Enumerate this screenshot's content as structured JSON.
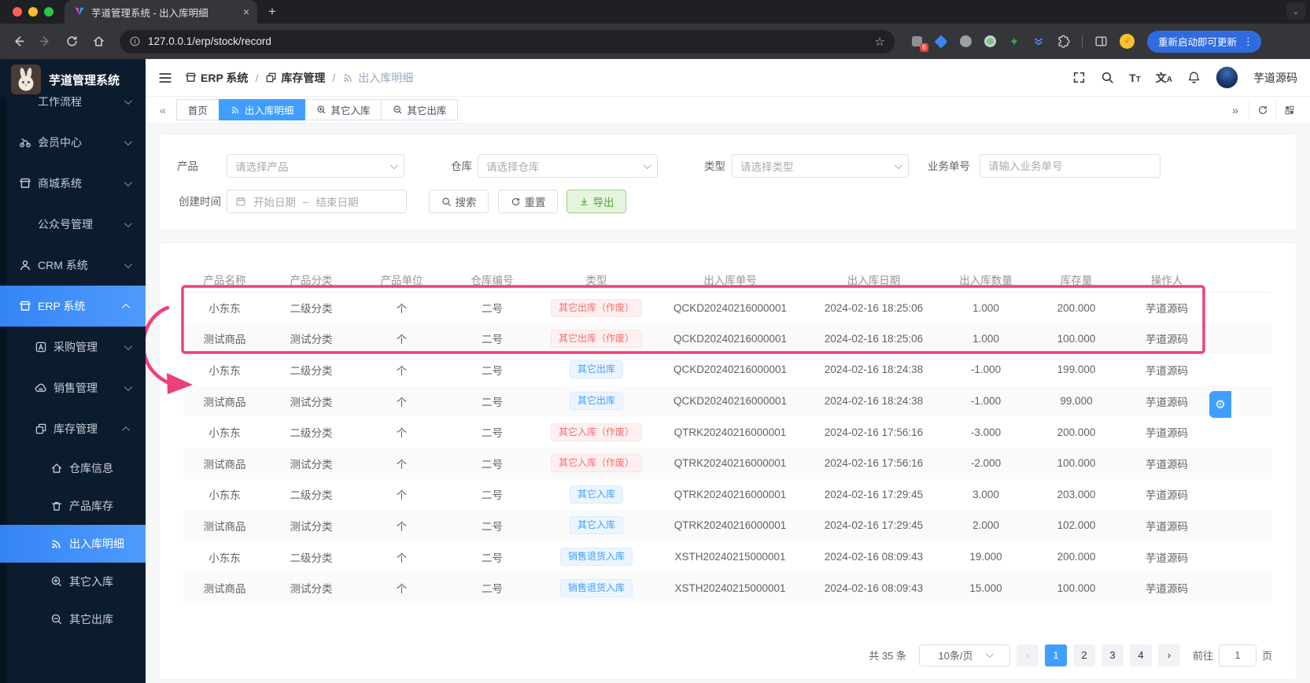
{
  "colors": {
    "accent": "#409eff",
    "annotation": "#ee4079",
    "tag_danger": "#f56c6c",
    "tag_primary": "#409eff",
    "success_button": "#51a83a",
    "sidebar_bg": "#0c1c2f"
  },
  "browser": {
    "tab_title": "芋道管理系统 - 出入库明细",
    "url": "127.0.0.1/erp/stock/record",
    "ext_badge": "6",
    "update_button": "重新启动即可更新"
  },
  "sidebar": {
    "app_title": "芋道管理系统",
    "items": [
      {
        "id": "workflow",
        "label": "工作流程",
        "icon": "",
        "level": 1,
        "chevron": "down",
        "cropped": true
      },
      {
        "id": "member-center",
        "label": "会员中心",
        "icon": "bike",
        "level": 1,
        "chevron": "down"
      },
      {
        "id": "mall-system",
        "label": "商城系统",
        "icon": "shop",
        "level": 1,
        "chevron": "down"
      },
      {
        "id": "mp-admin",
        "label": "公众号管理",
        "icon": "",
        "level": 1,
        "chevron": "down"
      },
      {
        "id": "crm-system",
        "label": "CRM 系统",
        "icon": "user",
        "level": 1,
        "chevron": "down"
      },
      {
        "id": "erp-system",
        "label": "ERP 系统",
        "icon": "shop",
        "level": 1,
        "chevron": "up",
        "active": true
      },
      {
        "id": "purchase",
        "label": "采购管理",
        "icon": "letter-a",
        "level": 2,
        "chevron": "down"
      },
      {
        "id": "sales",
        "label": "销售管理",
        "icon": "cloud",
        "level": 2,
        "chevron": "down"
      },
      {
        "id": "stock",
        "label": "库存管理",
        "icon": "squares",
        "level": 2,
        "chevron": "up"
      },
      {
        "id": "warehouse-info",
        "label": "仓库信息",
        "icon": "home",
        "level": 3
      },
      {
        "id": "product-stock",
        "label": "产品库存",
        "icon": "trash",
        "level": 3
      },
      {
        "id": "stock-record",
        "label": "出入库明细",
        "icon": "signal",
        "level": 3,
        "active": true
      },
      {
        "id": "other-in",
        "label": "其它入库",
        "icon": "zoom-plus",
        "level": 3
      },
      {
        "id": "other-out",
        "label": "其它出库",
        "icon": "zoom-minus",
        "level": 3
      }
    ]
  },
  "header": {
    "breadcrumb": [
      {
        "label": "ERP 系统",
        "icon": "shop"
      },
      {
        "label": "库存管理",
        "icon": "squares"
      },
      {
        "label": "出入库明细",
        "icon": "signal"
      }
    ],
    "breadcrumb_sep": "/",
    "username": "芋道源码"
  },
  "tabs": [
    {
      "id": "home",
      "label": "首页",
      "icon": ""
    },
    {
      "id": "stock-record",
      "label": "出入库明细",
      "icon": "signal",
      "active": true
    },
    {
      "id": "other-in",
      "label": "其它入库",
      "icon": "zoom-plus"
    },
    {
      "id": "other-out",
      "label": "其它出库",
      "icon": "zoom-minus"
    }
  ],
  "filters": {
    "product_label": "产品",
    "product_placeholder": "请选择产品",
    "warehouse_label": "仓库",
    "warehouse_placeholder": "请选择仓库",
    "type_label": "类型",
    "type_placeholder": "请选择类型",
    "bizno_label": "业务单号",
    "bizno_placeholder": "请输入业务单号",
    "created_label": "创建时间",
    "start_placeholder": "开始日期",
    "range_separator": "–",
    "end_placeholder": "结束日期",
    "search_label": "搜索",
    "reset_label": "重置",
    "export_label": "导出"
  },
  "table": {
    "columns": [
      "产品名称",
      "产品分类",
      "产品单位",
      "仓库编号",
      "类型",
      "出入库单号",
      "出入库日期",
      "出入库数量",
      "库存量",
      "操作人"
    ],
    "rows": [
      {
        "product": "小东东",
        "category": "二级分类",
        "unit": "个",
        "warehouse": "二号",
        "type": "其它出库（作废）",
        "variant": "danger",
        "order_no": "QCKD20240216000001",
        "date": "2024-02-16 18:25:06",
        "qty": "1.000",
        "stock": "200.000",
        "operator": "芋道源码"
      },
      {
        "product": "测试商品",
        "category": "测试分类",
        "unit": "个",
        "warehouse": "二号",
        "type": "其它出库（作废）",
        "variant": "danger",
        "order_no": "QCKD20240216000001",
        "date": "2024-02-16 18:25:06",
        "qty": "1.000",
        "stock": "100.000",
        "operator": "芋道源码"
      },
      {
        "product": "小东东",
        "category": "二级分类",
        "unit": "个",
        "warehouse": "二号",
        "type": "其它出库",
        "variant": "primary",
        "order_no": "QCKD20240216000001",
        "date": "2024-02-16 18:24:38",
        "qty": "-1.000",
        "stock": "199.000",
        "operator": "芋道源码"
      },
      {
        "product": "测试商品",
        "category": "测试分类",
        "unit": "个",
        "warehouse": "二号",
        "type": "其它出库",
        "variant": "primary",
        "order_no": "QCKD20240216000001",
        "date": "2024-02-16 18:24:38",
        "qty": "-1.000",
        "stock": "99.000",
        "operator": "芋道源码"
      },
      {
        "product": "小东东",
        "category": "二级分类",
        "unit": "个",
        "warehouse": "二号",
        "type": "其它入库（作废）",
        "variant": "danger",
        "order_no": "QTRK20240216000001",
        "date": "2024-02-16 17:56:16",
        "qty": "-3.000",
        "stock": "200.000",
        "operator": "芋道源码"
      },
      {
        "product": "测试商品",
        "category": "测试分类",
        "unit": "个",
        "warehouse": "二号",
        "type": "其它入库（作废）",
        "variant": "danger",
        "order_no": "QTRK20240216000001",
        "date": "2024-02-16 17:56:16",
        "qty": "-2.000",
        "stock": "100.000",
        "operator": "芋道源码"
      },
      {
        "product": "小东东",
        "category": "二级分类",
        "unit": "个",
        "warehouse": "二号",
        "type": "其它入库",
        "variant": "primary",
        "order_no": "QTRK20240216000001",
        "date": "2024-02-16 17:29:45",
        "qty": "3.000",
        "stock": "203.000",
        "operator": "芋道源码"
      },
      {
        "product": "测试商品",
        "category": "测试分类",
        "unit": "个",
        "warehouse": "二号",
        "type": "其它入库",
        "variant": "primary",
        "order_no": "QTRK20240216000001",
        "date": "2024-02-16 17:29:45",
        "qty": "2.000",
        "stock": "102.000",
        "operator": "芋道源码"
      },
      {
        "product": "小东东",
        "category": "二级分类",
        "unit": "个",
        "warehouse": "二号",
        "type": "销售退货入库",
        "variant": "primary",
        "order_no": "XSTH20240215000001",
        "date": "2024-02-16 08:09:43",
        "qty": "19.000",
        "stock": "200.000",
        "operator": "芋道源码"
      },
      {
        "product": "测试商品",
        "category": "测试分类",
        "unit": "个",
        "warehouse": "二号",
        "type": "销售退货入库",
        "variant": "primary",
        "order_no": "XSTH20240215000001",
        "date": "2024-02-16 08:09:43",
        "qty": "15.000",
        "stock": "100.000",
        "operator": "芋道源码"
      }
    ]
  },
  "pagination": {
    "total": "共 35 条",
    "page_size": "10条/页",
    "pages": [
      "1",
      "2",
      "3",
      "4"
    ],
    "active_page": "1",
    "goto_label": "前往",
    "goto_value": "1",
    "page_suffix": "页"
  }
}
